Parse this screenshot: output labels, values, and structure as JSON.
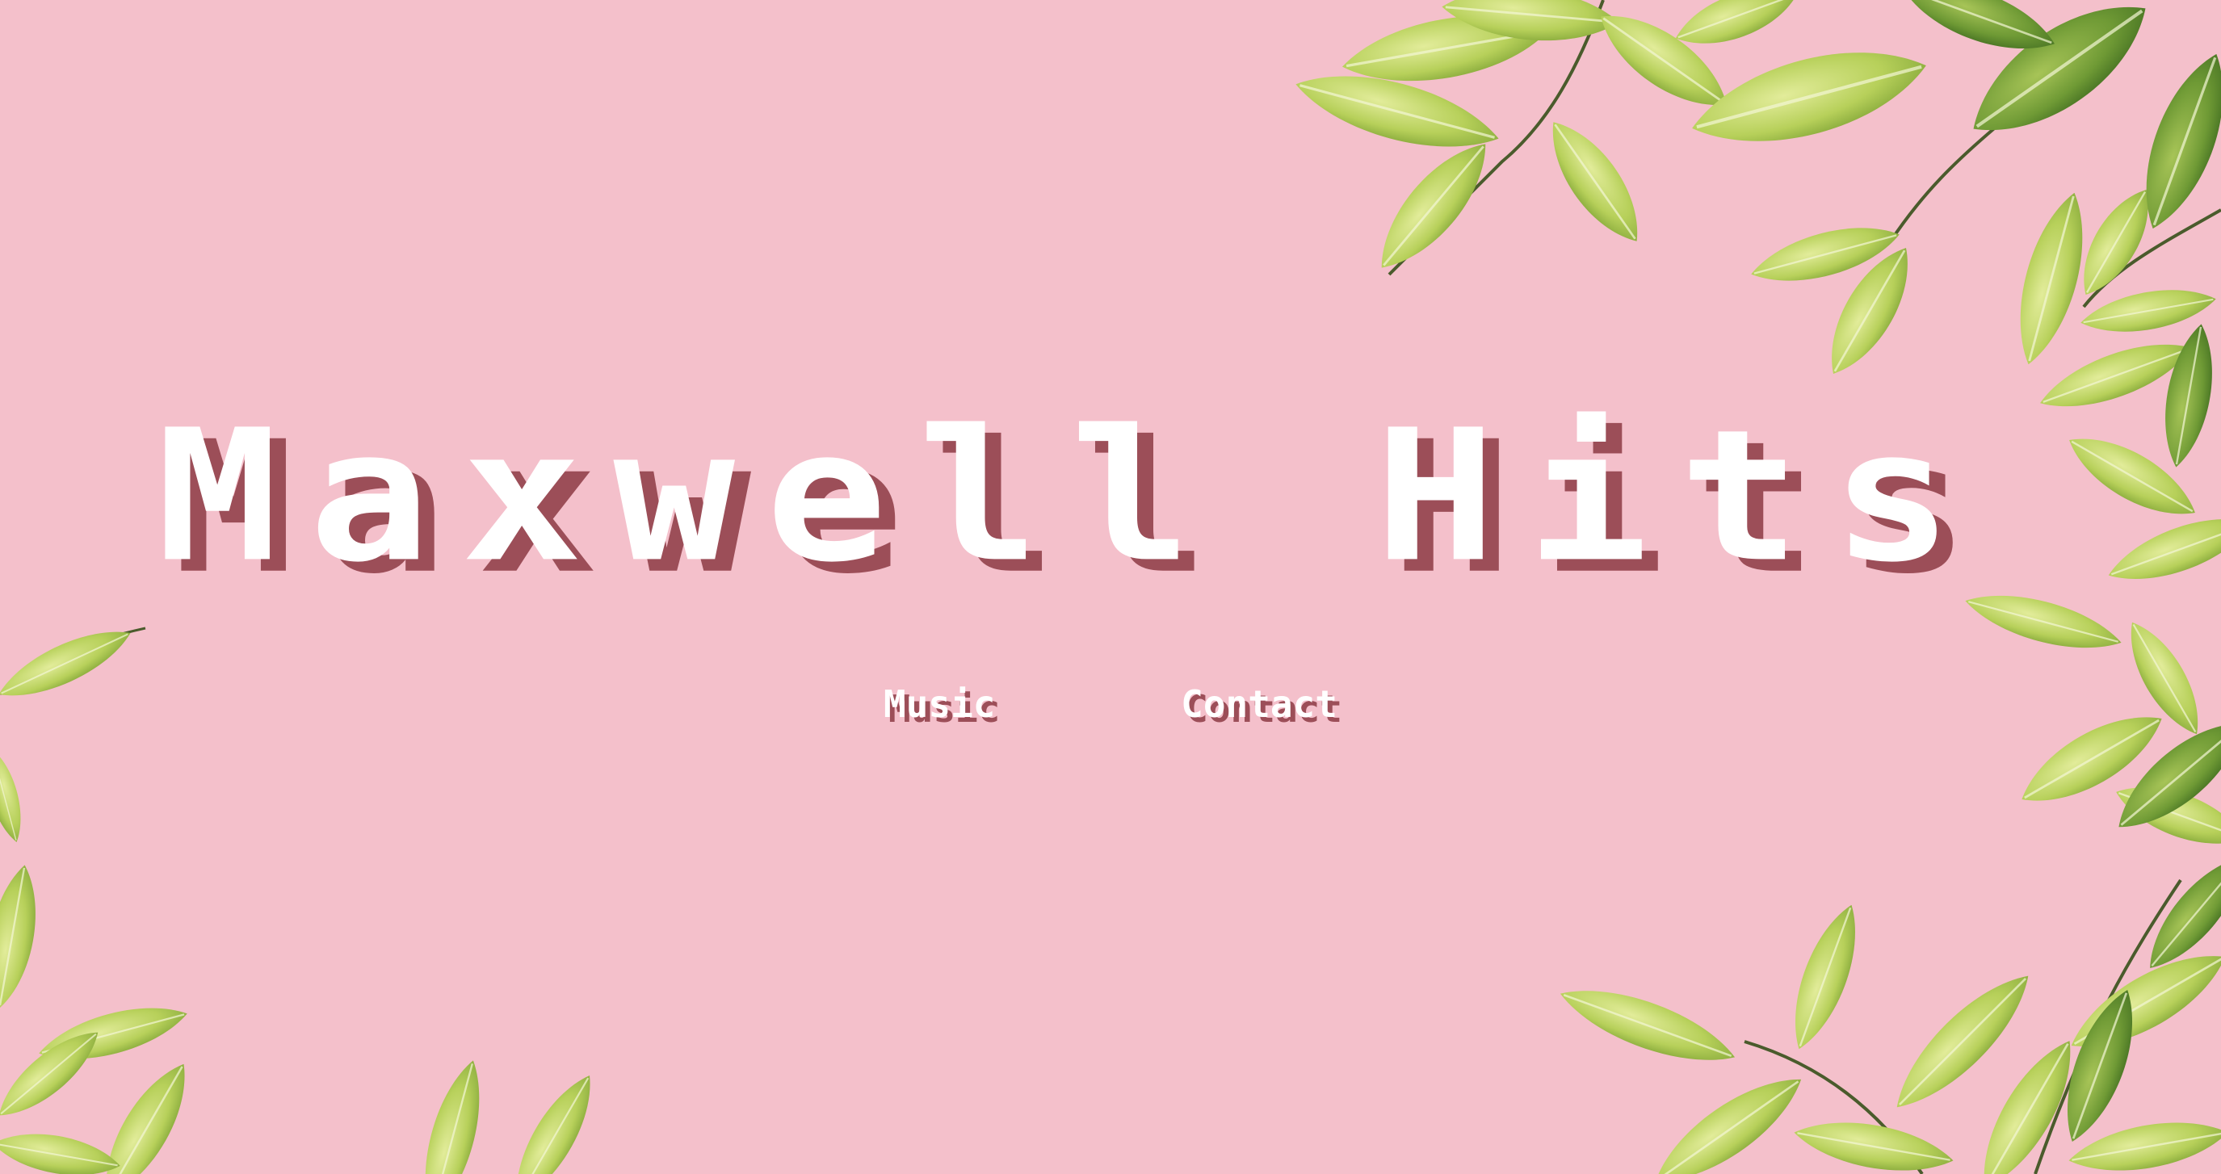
{
  "page": {
    "background_color": "#f4c0cb",
    "accent_shadow_color": "#9c4e58"
  },
  "header": {
    "title": "Maxwell Hits"
  },
  "nav": {
    "items": [
      {
        "label": "Music"
      },
      {
        "label": "Contact"
      }
    ]
  },
  "decoration": {
    "icon": "leaf-icon"
  }
}
